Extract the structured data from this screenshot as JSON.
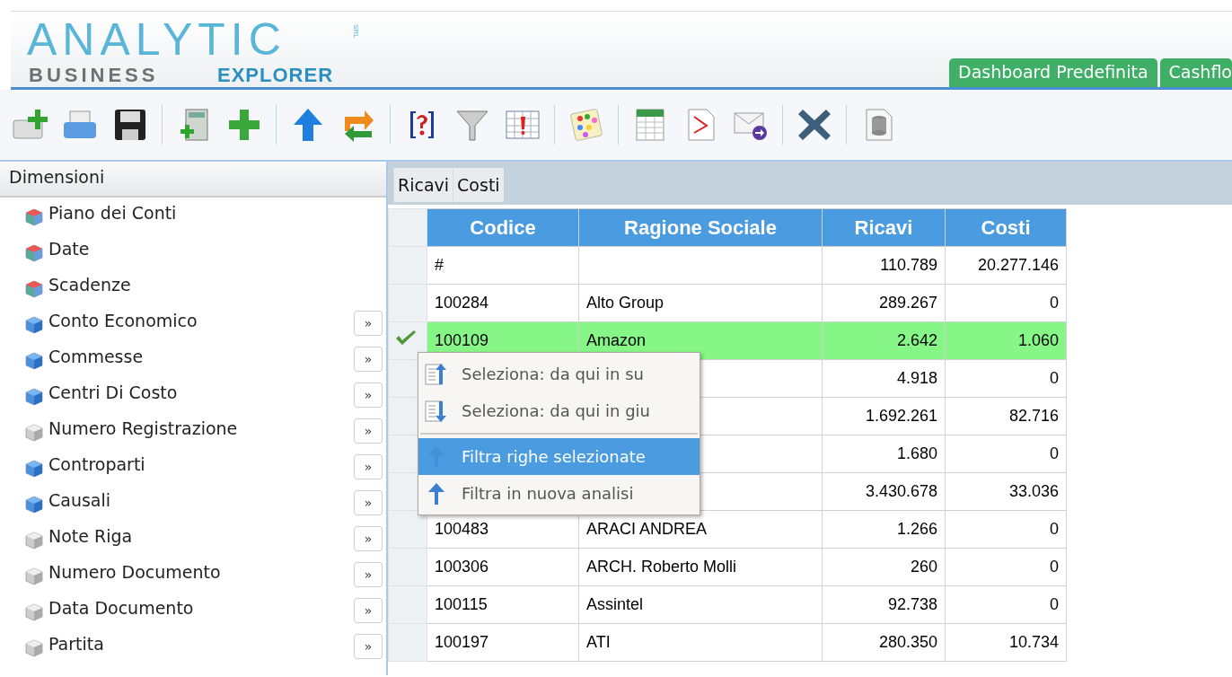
{
  "logo": {
    "title": "ANALYTIC",
    "suffix": "SRL",
    "line_left": "BUSINESS",
    "line_right": "EXPLORER"
  },
  "tabs": [
    "Dashboard Predefinita",
    "Cashflo"
  ],
  "sidebar": {
    "title": "Dimensioni",
    "items": [
      {
        "label": "Piano dei Conti",
        "kind": "multi"
      },
      {
        "label": "Date",
        "kind": "multi"
      },
      {
        "label": "Scadenze",
        "kind": "multi"
      },
      {
        "label": "Conto Economico",
        "kind": "blue",
        "button": "»"
      },
      {
        "label": "Commesse",
        "kind": "blue",
        "button": "»"
      },
      {
        "label": "Centri Di Costo",
        "kind": "blue",
        "button": "»"
      },
      {
        "label": "Numero Registrazione",
        "kind": "grey",
        "button": "»"
      },
      {
        "label": "Controparti",
        "kind": "blue",
        "button": "»"
      },
      {
        "label": "Causali",
        "kind": "blue",
        "button": "»"
      },
      {
        "label": "Note Riga",
        "kind": "grey",
        "button": "»"
      },
      {
        "label": "Numero Documento",
        "kind": "grey",
        "button": "»"
      },
      {
        "label": "Data Documento",
        "kind": "grey",
        "button": "»"
      },
      {
        "label": "Partita",
        "kind": "grey",
        "button": "»"
      }
    ]
  },
  "measures": [
    "Ricavi",
    "Costi"
  ],
  "table": {
    "columns": [
      "Codice",
      "Ragione Sociale",
      "Ricavi",
      "Costi"
    ],
    "rows": [
      {
        "selected": false,
        "cells": [
          "#",
          "",
          "110.789",
          "20.277.146"
        ]
      },
      {
        "selected": false,
        "cells": [
          "100284",
          "Alto Group",
          "289.267",
          "0"
        ]
      },
      {
        "selected": true,
        "cells": [
          "100109",
          "Amazon",
          "2.642",
          "1.060"
        ]
      },
      {
        "selected": false,
        "cells": [
          "",
          "",
          "4.918",
          "0"
        ]
      },
      {
        "selected": false,
        "cells": [
          "",
          "",
          "1.692.261",
          "82.716"
        ]
      },
      {
        "selected": false,
        "cells": [
          "",
          "",
          "1.680",
          "0"
        ]
      },
      {
        "selected": false,
        "cells": [
          "",
          "",
          "3.430.678",
          "33.036"
        ]
      },
      {
        "selected": false,
        "cells": [
          "100483",
          "ARACI ANDREA",
          "1.266",
          "0"
        ]
      },
      {
        "selected": false,
        "cells": [
          "100306",
          "ARCH. Roberto Molli",
          "260",
          "0"
        ]
      },
      {
        "selected": false,
        "cells": [
          "100115",
          "Assintel",
          "92.738",
          "0"
        ]
      },
      {
        "selected": false,
        "cells": [
          "100197",
          "ATI",
          "280.350",
          "10.734"
        ]
      }
    ]
  },
  "context_menu": {
    "groups": [
      [
        {
          "label": "Seleziona: da qui in su",
          "kind": "select-up",
          "selected": false
        },
        {
          "label": "Seleziona: da qui in giu",
          "kind": "select-down",
          "selected": false
        }
      ],
      [
        {
          "label": "Filtra righe selezionate",
          "kind": "filter",
          "selected": true
        },
        {
          "label": "Filtra in nuova analisi",
          "kind": "filter",
          "selected": false
        }
      ]
    ]
  }
}
